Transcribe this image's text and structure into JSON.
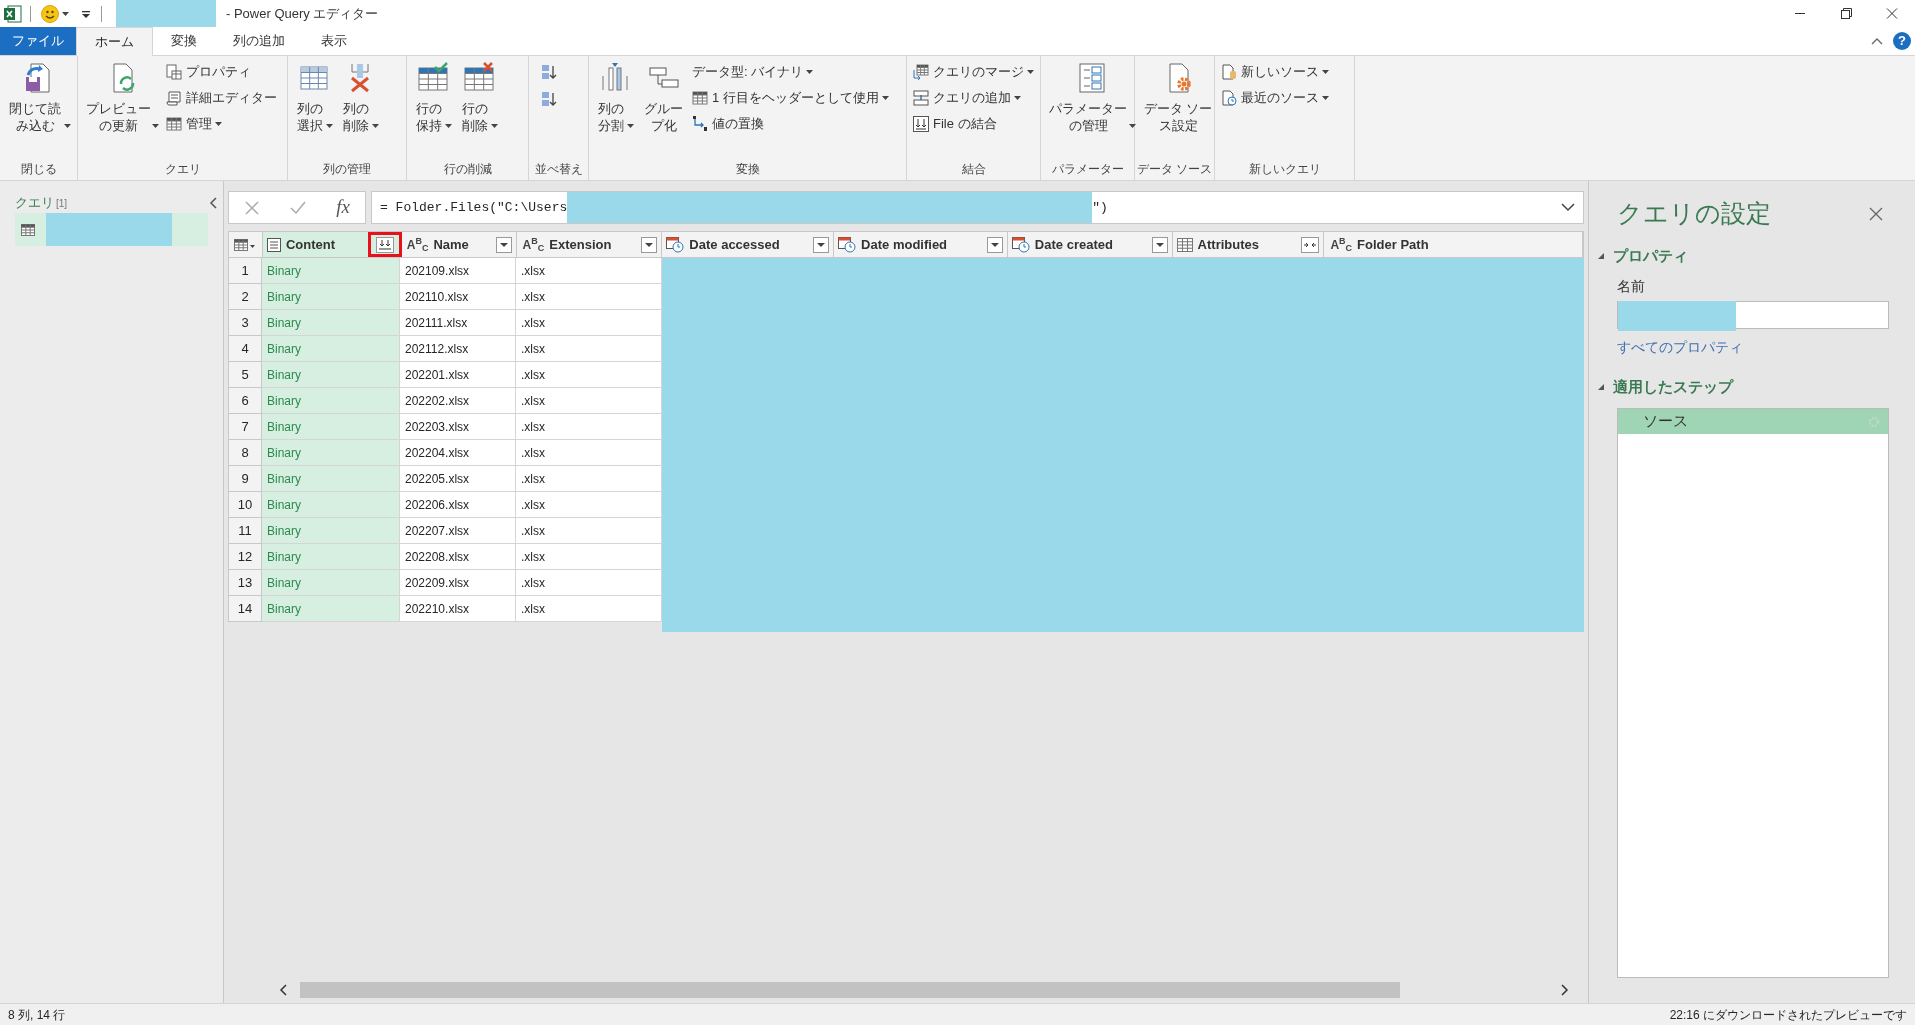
{
  "title_bar": {
    "title": "- Power Query エディター"
  },
  "ribbon_tabs": [
    {
      "label": "ファイル",
      "kind": "file",
      "selected": false
    },
    {
      "label": "ホーム",
      "kind": "tab",
      "selected": true
    },
    {
      "label": "変換",
      "kind": "tab",
      "selected": false
    },
    {
      "label": "列の追加",
      "kind": "tab",
      "selected": false
    },
    {
      "label": "表示",
      "kind": "tab",
      "selected": false
    }
  ],
  "help": "?",
  "ribbon_groups": [
    {
      "label": "閉じる",
      "items": [
        {
          "kind": "large",
          "label": "閉じて読み込む",
          "dropdown": true
        }
      ]
    },
    {
      "label": "クエリ",
      "items": [
        {
          "kind": "large",
          "label": "プレビューの更新",
          "dropdown": true
        },
        {
          "kind": "small",
          "label": "プロパティ",
          "dropdown": false
        },
        {
          "kind": "small",
          "label": "詳細エディター",
          "dropdown": false
        },
        {
          "kind": "small",
          "label": "管理",
          "dropdown": true
        }
      ]
    },
    {
      "label": "列の管理",
      "items": [
        {
          "kind": "large",
          "label": "列の選択",
          "dropdown": true
        },
        {
          "kind": "large",
          "label": "列の削除",
          "dropdown": true
        }
      ]
    },
    {
      "label": "行の削減",
      "items": [
        {
          "kind": "large",
          "label": "行の保持",
          "dropdown": true
        },
        {
          "kind": "large",
          "label": "行の削除",
          "dropdown": true
        }
      ]
    },
    {
      "label": "並べ替え",
      "items": [
        {
          "kind": "icon"
        },
        {
          "kind": "icon"
        }
      ]
    },
    {
      "label": "変換",
      "items": [
        {
          "kind": "large",
          "label": "列の分割",
          "dropdown": true
        },
        {
          "kind": "large",
          "label": "グループ化",
          "dropdown": false
        },
        {
          "kind": "small",
          "label": "データ型: バイナリ",
          "dropdown": true
        },
        {
          "kind": "small",
          "label": "1 行目をヘッダーとして使用",
          "dropdown": true
        },
        {
          "kind": "small",
          "label": "値の置換",
          "dropdown": false
        }
      ]
    },
    {
      "label": "結合",
      "items": [
        {
          "kind": "small",
          "label": "クエリのマージ",
          "dropdown": true
        },
        {
          "kind": "small",
          "label": "クエリの追加",
          "dropdown": true
        },
        {
          "kind": "small",
          "label": "File の結合",
          "dropdown": false
        }
      ]
    },
    {
      "label": "パラメーター",
      "items": [
        {
          "kind": "large",
          "label": "パラメーターの管理",
          "dropdown": true
        }
      ]
    },
    {
      "label": "データ ソース",
      "items": [
        {
          "kind": "large",
          "label": "データ ソース設定",
          "dropdown": false
        }
      ]
    },
    {
      "label": "新しいクエリ",
      "items": [
        {
          "kind": "small",
          "label": "新しいソース",
          "dropdown": true
        },
        {
          "kind": "small",
          "label": "最近のソース",
          "dropdown": true
        }
      ]
    }
  ],
  "query_pane": {
    "title": "クエリ",
    "count": "[1]",
    "queries": [
      {
        "selected": true
      }
    ]
  },
  "formula_bar": {
    "fx": "fx",
    "formula_start": "= Folder.Files(\"C:\\Users",
    "formula_end": "\")"
  },
  "table": {
    "columns": [
      {
        "label": "Content",
        "kind": "binary",
        "filter_button": false,
        "expand_button": true,
        "selected": true,
        "highlight": true
      },
      {
        "label": "Name",
        "kind": "text",
        "type_label": "A$^{B}$$_{C}$",
        "filter_button": true,
        "expand_button": false,
        "selected": false,
        "highlight": false
      },
      {
        "label": "Extension",
        "kind": "text",
        "type_label": "A$^{B}$$_{C}$",
        "filter_button": true,
        "expand_button": false,
        "selected": false,
        "highlight": false
      },
      {
        "label": "Date accessed",
        "kind": "datetime",
        "filter_button": true,
        "expand_button": false,
        "selected": false,
        "highlight": false
      },
      {
        "label": "Date modified",
        "kind": "datetime",
        "filter_button": true,
        "expand_button": false,
        "selected": false,
        "highlight": false
      },
      {
        "label": "Date created",
        "kind": "datetime",
        "filter_button": true,
        "expand_button": false,
        "selected": false,
        "highlight": false
      },
      {
        "label": "Attributes",
        "kind": "record",
        "filter_button": false,
        "expand_button": true,
        "selected": false,
        "highlight": false
      },
      {
        "label": "Folder Path",
        "kind": "text",
        "type_label": "A$^{B}$$_{C}$",
        "filter_button": false,
        "expand_button": false,
        "selected": false,
        "highlight": false
      }
    ],
    "rows": [
      {
        "number": "1",
        "cells": [
          "Binary",
          "202109.xlsx",
          ".xlsx"
        ]
      },
      {
        "number": "2",
        "cells": [
          "Binary",
          "202110.xlsx",
          ".xlsx"
        ]
      },
      {
        "number": "3",
        "cells": [
          "Binary",
          "202111.xlsx",
          ".xlsx"
        ]
      },
      {
        "number": "4",
        "cells": [
          "Binary",
          "202112.xlsx",
          ".xlsx"
        ]
      },
      {
        "number": "5",
        "cells": [
          "Binary",
          "202201.xlsx",
          ".xlsx"
        ]
      },
      {
        "number": "6",
        "cells": [
          "Binary",
          "202202.xlsx",
          ".xlsx"
        ]
      },
      {
        "number": "7",
        "cells": [
          "Binary",
          "202203.xlsx",
          ".xlsx"
        ]
      },
      {
        "number": "8",
        "cells": [
          "Binary",
          "202204.xlsx",
          ".xlsx"
        ]
      },
      {
        "number": "9",
        "cells": [
          "Binary",
          "202205.xlsx",
          ".xlsx"
        ]
      },
      {
        "number": "10",
        "cells": [
          "Binary",
          "202206.xlsx",
          ".xlsx"
        ]
      },
      {
        "number": "11",
        "cells": [
          "Binary",
          "202207.xlsx",
          ".xlsx"
        ]
      },
      {
        "number": "12",
        "cells": [
          "Binary",
          "202208.xlsx",
          ".xlsx"
        ]
      },
      {
        "number": "13",
        "cells": [
          "Binary",
          "202209.xlsx",
          ".xlsx"
        ]
      },
      {
        "number": "14",
        "cells": [
          "Binary",
          "202210.xlsx",
          ".xlsx"
        ]
      }
    ]
  },
  "query_settings": {
    "title": "クエリの設定",
    "properties": {
      "heading": "プロパティ",
      "expanded": true,
      "name_label": "名前",
      "all_properties_link": "すべてのプロパティ"
    },
    "steps": {
      "heading": "適用したステップ",
      "expanded": true,
      "items": [
        {
          "label": "ソース",
          "selected": true
        }
      ]
    }
  },
  "status_bar": {
    "left": "8 列, 14 行",
    "right": "22:16 にダウンロードされたプレビューです"
  }
}
